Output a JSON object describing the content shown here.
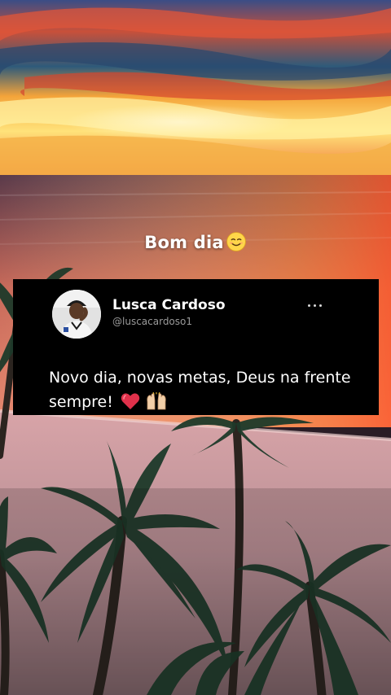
{
  "caption": {
    "text": "Bom dia",
    "emoji_icon": "smiling-face-icon"
  },
  "tweet": {
    "author_name": "Lusca Cardoso",
    "author_handle": "@luscacardoso1",
    "more_icon": "more-horizontal-icon",
    "text": "Novo dia, novas metas, Deus na frente sempre!",
    "emojis": [
      "red-heart-icon",
      "raising-hands-icon"
    ]
  },
  "colors": {
    "card_background": "#000000",
    "primary_text": "#ffffff",
    "secondary_text": "#9a9a9a",
    "heart": "#e0314b"
  }
}
